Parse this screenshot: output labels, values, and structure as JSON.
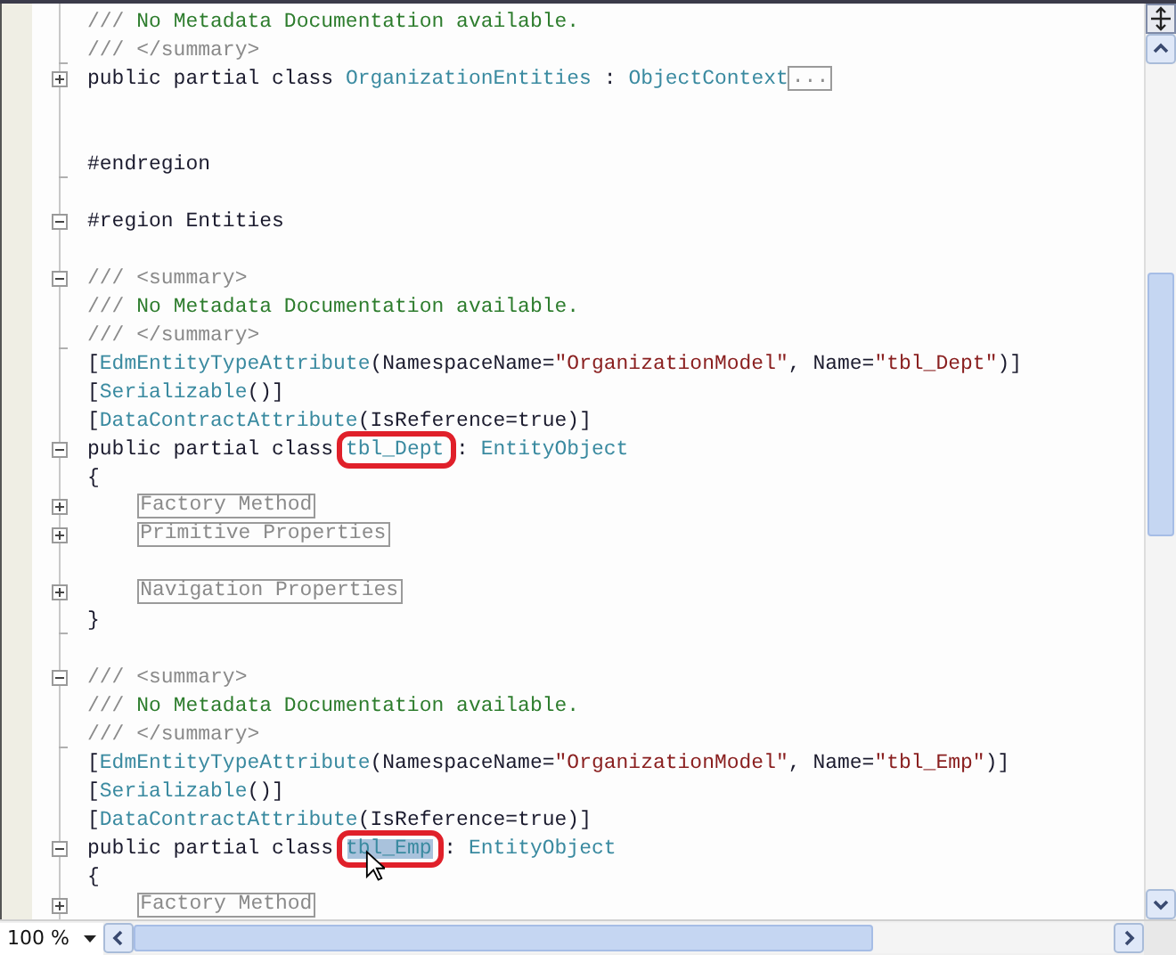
{
  "editor": {
    "lines": [
      {
        "kind": "line",
        "segments": [
          {
            "kind": "doc",
            "text": "/// "
          },
          {
            "kind": "comment",
            "text": "No Metadata Documentation available."
          }
        ]
      },
      {
        "kind": "end",
        "segments": [
          {
            "kind": "doc",
            "text": "/// </summary>"
          }
        ]
      },
      {
        "kind": "plus",
        "segments": [
          {
            "kind": "keyword",
            "text": "public partial class "
          },
          {
            "kind": "type",
            "text": "OrganizationEntities"
          },
          {
            "kind": "plain",
            "text": " : "
          },
          {
            "kind": "type",
            "text": "ObjectContext"
          },
          {
            "kind": "collapsed",
            "text": "..."
          }
        ]
      },
      {
        "kind": "line"
      },
      {
        "kind": "line"
      },
      {
        "kind": "end",
        "segments": [
          {
            "kind": "keyword",
            "text": "#endregion"
          }
        ]
      },
      {
        "kind": "none"
      },
      {
        "kind": "minus",
        "segments": [
          {
            "kind": "keyword",
            "text": "#region Entities"
          }
        ]
      },
      {
        "kind": "line"
      },
      {
        "kind": "minus",
        "segments": [
          {
            "kind": "doc",
            "text": "/// <summary>"
          }
        ]
      },
      {
        "kind": "line",
        "segments": [
          {
            "kind": "doc",
            "text": "/// "
          },
          {
            "kind": "comment",
            "text": "No Metadata Documentation available."
          }
        ]
      },
      {
        "kind": "end",
        "segments": [
          {
            "kind": "doc",
            "text": "/// </summary>"
          }
        ]
      },
      {
        "kind": "line",
        "segments": [
          {
            "kind": "plain",
            "text": "["
          },
          {
            "kind": "type",
            "text": "EdmEntityTypeAttribute"
          },
          {
            "kind": "plain",
            "text": "(NamespaceName="
          },
          {
            "kind": "string",
            "text": "\"OrganizationModel\""
          },
          {
            "kind": "plain",
            "text": ", Name="
          },
          {
            "kind": "string",
            "text": "\"tbl_Dept\""
          },
          {
            "kind": "plain",
            "text": ")]"
          }
        ]
      },
      {
        "kind": "line",
        "segments": [
          {
            "kind": "plain",
            "text": "["
          },
          {
            "kind": "type",
            "text": "Serializable"
          },
          {
            "kind": "plain",
            "text": "()]"
          }
        ]
      },
      {
        "kind": "line",
        "segments": [
          {
            "kind": "plain",
            "text": "["
          },
          {
            "kind": "type",
            "text": "DataContractAttribute"
          },
          {
            "kind": "plain",
            "text": "(IsReference=true)]"
          }
        ]
      },
      {
        "kind": "minus",
        "segments": [
          {
            "kind": "keyword",
            "text": "public partial class "
          },
          {
            "kind": "type",
            "text": "tbl_Dept",
            "circled": true,
            "selected": false,
            "pointer": false
          },
          {
            "kind": "plain",
            "text": " : "
          },
          {
            "kind": "type",
            "text": "EntityObject"
          }
        ]
      },
      {
        "kind": "line",
        "segments": [
          {
            "kind": "plain",
            "text": "{"
          }
        ],
        "children": [
          {
            "kind": "plus",
            "segments": [
              {
                "kind": "collapsed",
                "text": "Factory Method"
              }
            ]
          },
          {
            "kind": "plus",
            "segments": [
              {
                "kind": "collapsed",
                "text": "Primitive Properties"
              }
            ]
          },
          {
            "kind": "line"
          },
          {
            "kind": "plus",
            "segments": [
              {
                "kind": "collapsed",
                "text": "Navigation Properties"
              }
            ]
          }
        ]
      },
      {
        "kind": "end",
        "segments": [
          {
            "kind": "plain",
            "text": "}"
          }
        ]
      },
      {
        "kind": "line"
      },
      {
        "kind": "minus",
        "segments": [
          {
            "kind": "doc",
            "text": "/// <summary>"
          }
        ]
      },
      {
        "kind": "line",
        "segments": [
          {
            "kind": "doc",
            "text": "/// "
          },
          {
            "kind": "comment",
            "text": "No Metadata Documentation available."
          }
        ]
      },
      {
        "kind": "end",
        "segments": [
          {
            "kind": "doc",
            "text": "/// </summary>"
          }
        ]
      },
      {
        "kind": "line",
        "segments": [
          {
            "kind": "plain",
            "text": "["
          },
          {
            "kind": "type",
            "text": "EdmEntityTypeAttribute"
          },
          {
            "kind": "plain",
            "text": "(NamespaceName="
          },
          {
            "kind": "string",
            "text": "\"OrganizationModel\""
          },
          {
            "kind": "plain",
            "text": ", Name="
          },
          {
            "kind": "string",
            "text": "\"tbl_Emp\""
          },
          {
            "kind": "plain",
            "text": ")]"
          }
        ]
      },
      {
        "kind": "line",
        "segments": [
          {
            "kind": "plain",
            "text": "["
          },
          {
            "kind": "type",
            "text": "Serializable"
          },
          {
            "kind": "plain",
            "text": "()]"
          }
        ]
      },
      {
        "kind": "line",
        "segments": [
          {
            "kind": "plain",
            "text": "["
          },
          {
            "kind": "type",
            "text": "DataContractAttribute"
          },
          {
            "kind": "plain",
            "text": "(IsReference=true)]"
          }
        ]
      },
      {
        "kind": "minus",
        "segments": [
          {
            "kind": "keyword",
            "text": "public partial class "
          },
          {
            "kind": "type",
            "text": "tbl_Emp",
            "circled": true,
            "selected": true,
            "pointer": true
          },
          {
            "kind": "plain",
            "text": " : "
          },
          {
            "kind": "type",
            "text": "EntityObject"
          }
        ]
      },
      {
        "kind": "line",
        "segments": [
          {
            "kind": "plain",
            "text": "{"
          }
        ],
        "children": [
          {
            "kind": "plus",
            "segments": [
              {
                "kind": "collapsed",
                "text": "Factory Method"
              }
            ]
          }
        ]
      }
    ]
  },
  "status_bar": {
    "zoom": "100 %"
  }
}
